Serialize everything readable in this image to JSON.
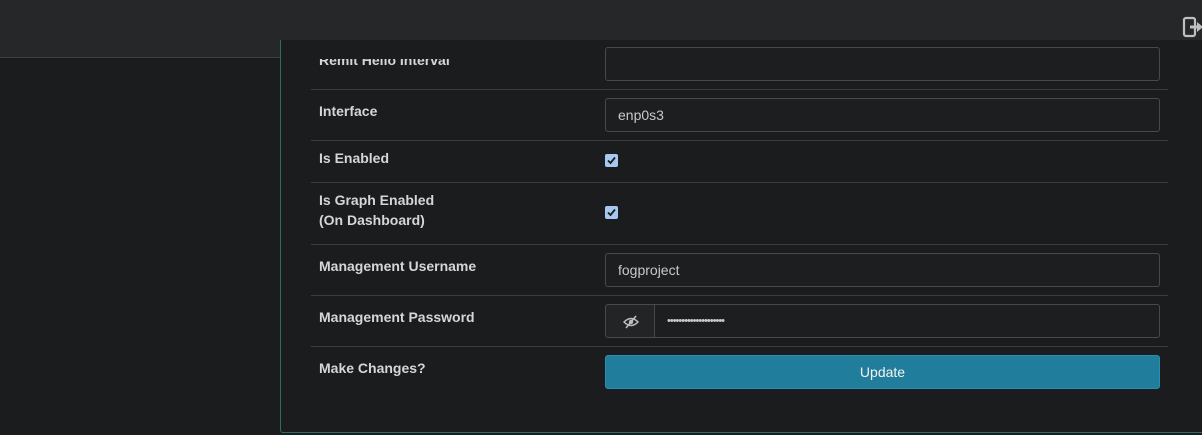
{
  "form": {
    "rows": {
      "remit": {
        "label": "Remit Hello Interval",
        "value": ""
      },
      "interface": {
        "label": "Interface",
        "value": "enp0s3"
      },
      "enabled": {
        "label": "Is Enabled",
        "checked": true
      },
      "graph": {
        "label_line1": "Is Graph Enabled",
        "label_line2": "(On Dashboard)",
        "checked": true
      },
      "mgmt_user": {
        "label": "Management Username",
        "value": "fogproject"
      },
      "mgmt_pass": {
        "label": "Management Password",
        "value": "••••••••••••••••••••"
      },
      "changes": {
        "label": "Make Changes?",
        "button": "Update"
      }
    }
  },
  "icons": {
    "logout": "logout-icon",
    "password_toggle": "eye-slash-icon",
    "check": "check-icon"
  },
  "colors": {
    "accent_button": "#217d9c",
    "panel_border": "#2f6a67",
    "checkbox": "#a7c8f0"
  }
}
